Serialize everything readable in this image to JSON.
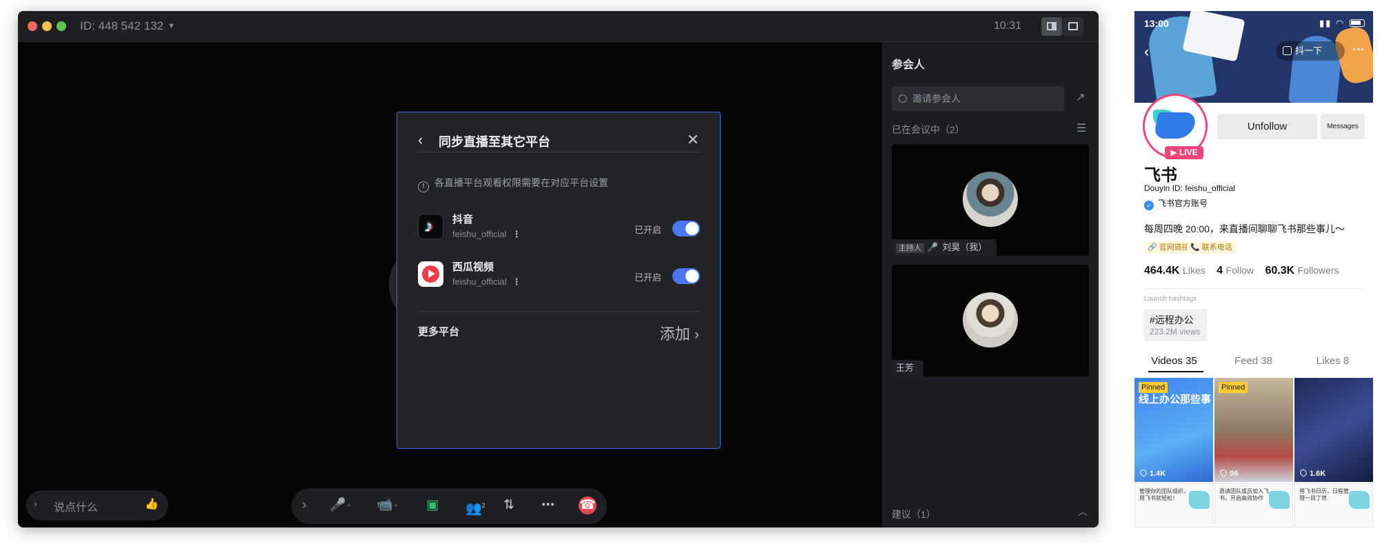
{
  "window": {
    "meeting_id": "ID: 448 542 132",
    "time": "10:31"
  },
  "modal": {
    "title": "同步直播至其它平台",
    "hint": "各直播平台观看权限需要在对应平台设置",
    "platforms": [
      {
        "name": "抖音",
        "account": "feishu_official",
        "status": "已开启",
        "enabled": true
      },
      {
        "name": "西瓜视频",
        "account": "feishu_official",
        "status": "已开启",
        "enabled": true
      }
    ],
    "more_label": "更多平台",
    "add_label": "添加"
  },
  "chat": {
    "placeholder": "说点什么"
  },
  "controls": {
    "participant_count": "2"
  },
  "participants": {
    "title": "参会人",
    "search_placeholder": "邀请参会人",
    "in_meeting": "已在会议中（2）",
    "people": [
      {
        "host_badge": "主持人",
        "name": "刘昊（我）"
      },
      {
        "name": "王芳"
      }
    ],
    "suggestions": "建议（1）"
  },
  "phone": {
    "status_time": "13:00",
    "shake_label": "抖一下",
    "unfollow_label": "Unfollow",
    "messages_label": "Messages",
    "live_badge": "LIVE",
    "name": "飞书",
    "douyin_id": "Douyin ID: feishu_official",
    "verified": "飞书官方账号",
    "bio": "每周四晚 20:00，来直播间聊聊飞书那些事儿～",
    "chips": [
      "官网链接",
      "联系电话"
    ],
    "stats": [
      {
        "value": "464.4K",
        "label": "Likes"
      },
      {
        "value": "4",
        "label": "Follow"
      },
      {
        "value": "60.3K",
        "label": "Followers"
      }
    ],
    "launch_label": "Launch hashtags",
    "hashtag": {
      "tag": "#远程办公",
      "views": "223.2M views"
    },
    "tabs": [
      "Videos 35",
      "Feed 38",
      "Likes 8"
    ],
    "videos": [
      {
        "pinned": "Pinned",
        "title": "线上办公那些事",
        "likes": "1.4K"
      },
      {
        "pinned": "Pinned",
        "likes": "96"
      },
      {
        "likes": "1.6K"
      }
    ],
    "bottom_videos": [
      {
        "text": "管理你的团队组织，用飞书就轻松！"
      },
      {
        "text": "邀请团队成员加入飞书，开启高效协作"
      },
      {
        "text": "用飞书日历，日程管理一目了然"
      }
    ]
  }
}
